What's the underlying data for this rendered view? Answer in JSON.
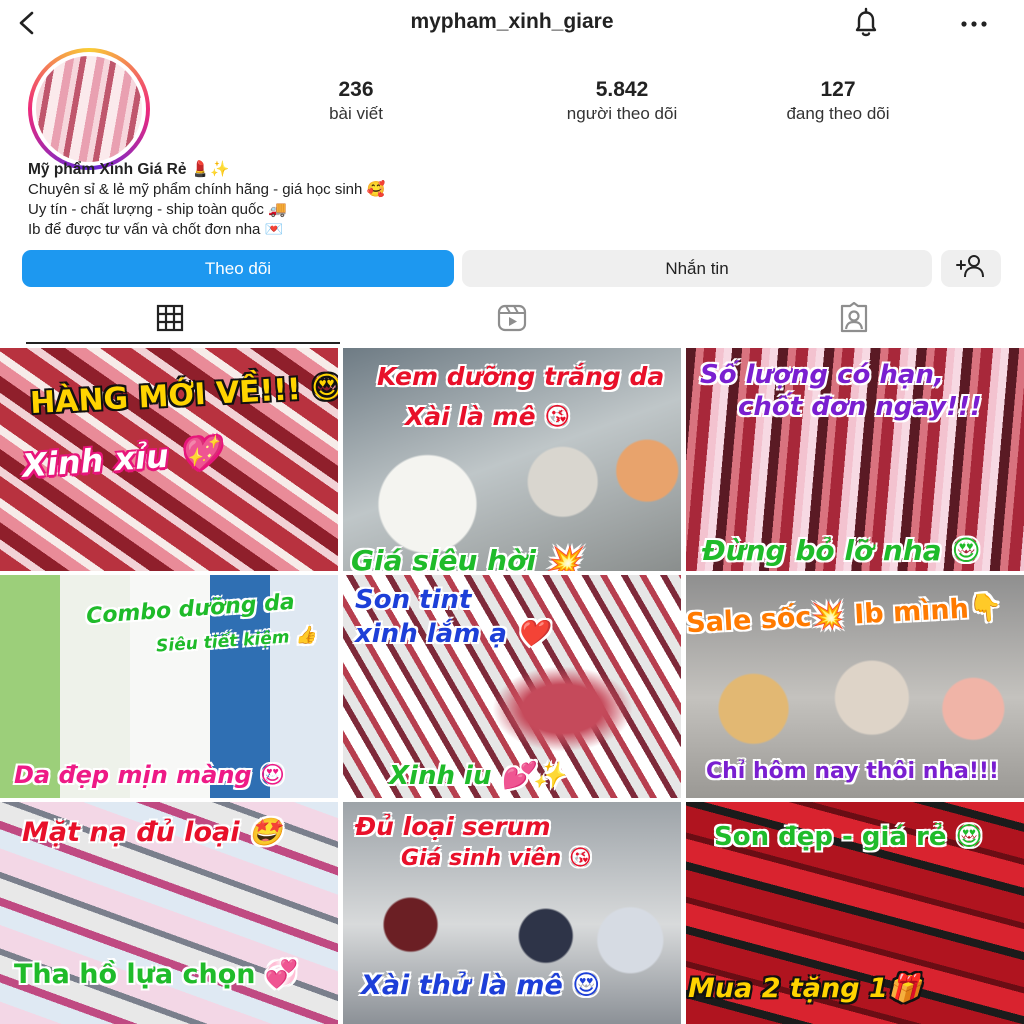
{
  "header": {
    "username": "mypham_xinh_giare"
  },
  "stats": [
    {
      "value": "236",
      "label": "bài viết"
    },
    {
      "value": "5.842",
      "label": "người theo dõi"
    },
    {
      "value": "127",
      "label": "đang theo dõi"
    }
  ],
  "bio": {
    "name": "Mỹ phẩm Xinh Giá Rẻ 💄✨",
    "lines": [
      "Chuyên sỉ & lẻ mỹ phẩm chính hãng - giá học sinh 🥰",
      "Uy tín - chất lượng - ship toàn quốc 🚚",
      "Ib để được tư vấn và chốt đơn nha 💌"
    ]
  },
  "actions": {
    "follow_label": "Theo dõi",
    "message_label": "Nhắn tin"
  },
  "colors": {
    "follow_button": "#1d98f0",
    "secondary_button": "#efefef"
  },
  "posts": [
    {
      "captions": [
        "HÀNG MỚI VỀ!!! 😍",
        "Xinh xỉu 💖"
      ]
    },
    {
      "captions": [
        "Kem dưỡng trắng da",
        "Xài là mê 😘",
        "Giá siêu hời 💥"
      ]
    },
    {
      "captions": [
        "Số lượng có hạn,",
        "chốt đơn ngay!!!",
        "Đừng bỏ lỡ nha 😍"
      ]
    },
    {
      "captions": [
        "Combo dưỡng da",
        "Siêu tiết kiệm 👍",
        "Da đẹp mịn màng 😍"
      ]
    },
    {
      "captions": [
        "Son tint",
        "xinh lắm ạ ❤️",
        "Xinh iu 💕✨"
      ]
    },
    {
      "captions": [
        "Sale sốc💥 Ib mình👇",
        "Chỉ hôm nay thôi nha!!!"
      ]
    },
    {
      "captions": [
        "Mặt nạ đủ loại 🤩",
        "Tha hồ lựa chọn 💞"
      ]
    },
    {
      "captions": [
        "Đủ loại serum",
        "Giá sinh viên 😘",
        "Xài thử là mê 😍"
      ]
    },
    {
      "captions": [
        "Son đẹp - giá rẻ 😍",
        "Mua 2 tặng 1🎁"
      ]
    }
  ]
}
